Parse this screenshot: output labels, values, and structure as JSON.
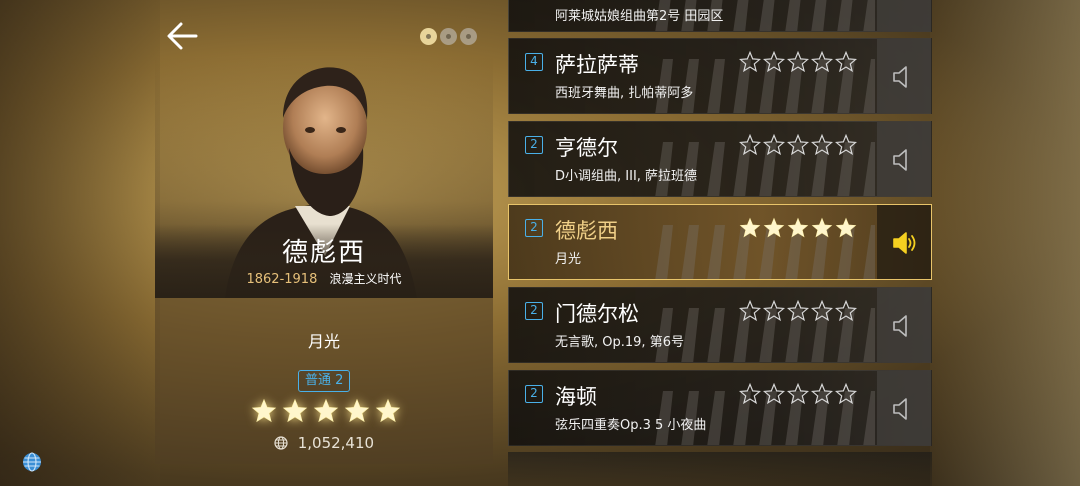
{
  "composer": {
    "name": "德彪西",
    "years": "1862-1918",
    "era": "浪漫主义时代"
  },
  "selected_piece": {
    "title": "月光",
    "difficulty_label": "普通 2",
    "stars_filled": 5,
    "stars_total": 5,
    "play_count": "1,052,410"
  },
  "pager": {
    "pages": 3,
    "active_index": 0
  },
  "songs": [
    {
      "level": "",
      "title": "",
      "subtitle": "阿莱城姑娘组曲第2号 田园区",
      "stars": 0,
      "partial": true
    },
    {
      "level": "4",
      "title": "萨拉萨蒂",
      "subtitle": "西班牙舞曲, 扎帕蒂阿多",
      "stars": 0,
      "selected": false
    },
    {
      "level": "2",
      "title": "亨德尔",
      "subtitle": "D小调组曲, III, 萨拉班德",
      "stars": 0,
      "selected": false
    },
    {
      "level": "2",
      "title": "德彪西",
      "subtitle": "月光",
      "stars": 5,
      "selected": true
    },
    {
      "level": "2",
      "title": "门德尔松",
      "subtitle": "无言歌, Op.19, 第6号",
      "stars": 0,
      "selected": false
    },
    {
      "level": "2",
      "title": "海顿",
      "subtitle": "弦乐四重奏Op.3 5 小夜曲",
      "stars": 0,
      "selected": false
    }
  ],
  "icons": {
    "back": "arrow-left-icon",
    "globe": "globe-icon",
    "speaker": "speaker-icon",
    "star": "star-icon"
  },
  "colors": {
    "accent_gold": "#f0d088",
    "accent_blue": "#4ab0e8",
    "star_fill": "#fff6cc"
  }
}
